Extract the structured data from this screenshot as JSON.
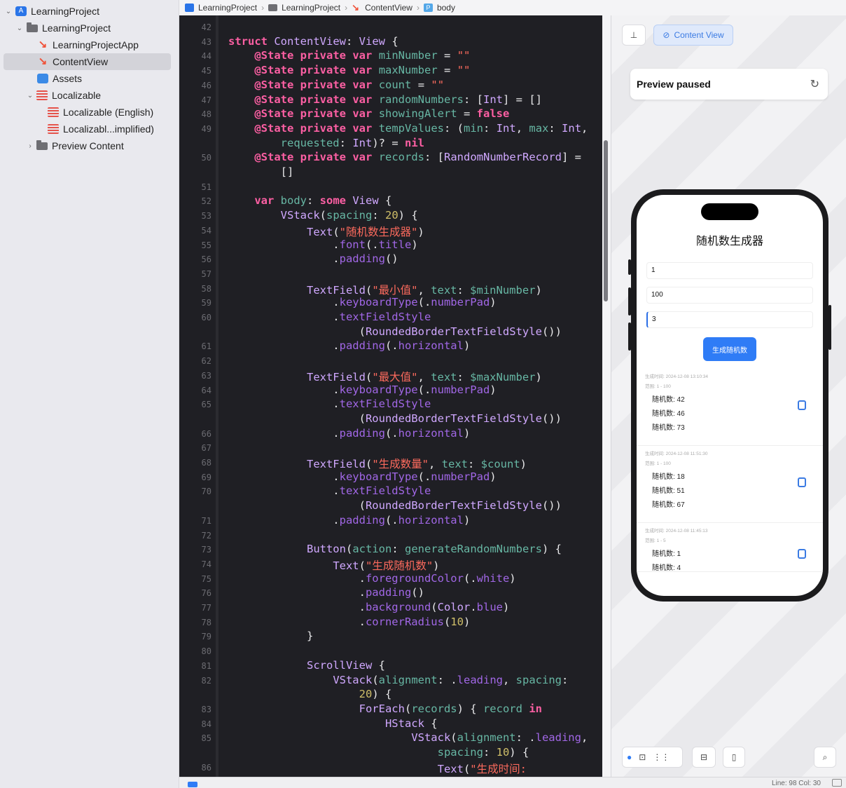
{
  "sidebar": {
    "items": [
      {
        "label": "LearningProject"
      },
      {
        "label": "LearningProject"
      },
      {
        "label": "LearningProjectApp"
      },
      {
        "label": "ContentView"
      },
      {
        "label": "Assets"
      },
      {
        "label": "Localizable"
      },
      {
        "label": "Localizable (English)"
      },
      {
        "label": "Localizabl...implified)"
      },
      {
        "label": "Preview Content"
      }
    ]
  },
  "breadcrumb": [
    "LearningProject",
    "LearningProject",
    "ContentView",
    "body"
  ],
  "editor": {
    "line_numbers": [
      "42",
      "43",
      "44",
      "45",
      "46",
      "47",
      "48",
      "49",
      "",
      "50",
      "",
      "51",
      "52",
      "53",
      "54",
      "55",
      "56",
      "57",
      "58",
      "59",
      "60",
      "",
      "61",
      "62",
      "63",
      "64",
      "65",
      "",
      "66",
      "67",
      "68",
      "69",
      "70",
      "",
      "71",
      "72",
      "73",
      "74",
      "75",
      "76",
      "77",
      "78",
      "79",
      "80",
      "81",
      "82",
      "",
      "83",
      "84",
      "85",
      "",
      "86"
    ],
    "code_lines": [
      "",
      "struct ContentView: View {",
      "    @State private var minNumber = \"\"",
      "    @State private var maxNumber = \"\"",
      "    @State private var count = \"\"",
      "    @State private var randomNumbers: [Int] = []",
      "    @State private var showingAlert = false",
      "    @State private var tempValues: (min: Int, max: Int,",
      "        requested: Int)? = nil",
      "    @State private var records: [RandomNumberRecord] =",
      "        []",
      "",
      "    var body: some View {",
      "        VStack(spacing: 20) {",
      "            Text(\"随机数生成器\")",
      "                .font(.title)",
      "                .padding()",
      "",
      "            TextField(\"最小值\", text: $minNumber)",
      "                .keyboardType(.numberPad)",
      "                .textFieldStyle",
      "                    (RoundedBorderTextFieldStyle())",
      "                .padding(.horizontal)",
      "",
      "            TextField(\"最大值\", text: $maxNumber)",
      "                .keyboardType(.numberPad)",
      "                .textFieldStyle",
      "                    (RoundedBorderTextFieldStyle())",
      "                .padding(.horizontal)",
      "",
      "            TextField(\"生成数量\", text: $count)",
      "                .keyboardType(.numberPad)",
      "                .textFieldStyle",
      "                    (RoundedBorderTextFieldStyle())",
      "                .padding(.horizontal)",
      "",
      "            Button(action: generateRandomNumbers) {",
      "                Text(\"生成随机数\")",
      "                    .foregroundColor(.white)",
      "                    .padding()",
      "                    .background(Color.blue)",
      "                    .cornerRadius(10)",
      "            }",
      "",
      "            ScrollView {",
      "                VStack(alignment: .leading, spacing:",
      "                    20) {",
      "                    ForEach(records) { record in",
      "                        HStack {",
      "                            VStack(alignment: .leading,",
      "                                spacing: 10) {",
      "                                Text(\"生成时间:"
    ]
  },
  "preview": {
    "content_view_label": "Content View",
    "status_title": "Preview paused",
    "app": {
      "title": "随机数生成器",
      "min_value": "1",
      "max_value": "100",
      "count_value": "3",
      "button_label": "生成随机数",
      "records": [
        {
          "time": "生成时间: 2024-12-08 13:10:34",
          "range": "范围: 1 - 100",
          "values": [
            "随机数: 42",
            "随机数: 46",
            "随机数: 73"
          ]
        },
        {
          "time": "生成时间: 2024-12-08 11:51:30",
          "range": "范围: 1 - 100",
          "values": [
            "随机数: 18",
            "随机数: 51",
            "随机数: 67"
          ]
        },
        {
          "time": "生成时间: 2024-12-08 11:45:13",
          "range": "范围: 1 - 5",
          "values": [
            "随机数: 1",
            "随机数: 4"
          ]
        }
      ]
    }
  },
  "statusbar": {
    "position": "Line: 98  Col: 30"
  },
  "colors": {
    "accent": "#2f7cf6",
    "editor_bg": "#1f1f24",
    "keyword": "#fc5fa3",
    "string": "#fc6a5d"
  }
}
